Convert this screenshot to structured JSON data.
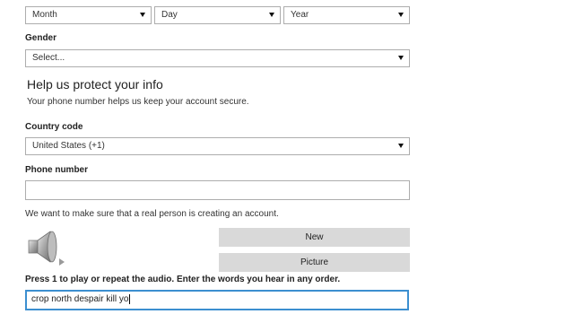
{
  "birthdate": {
    "month": "Month",
    "day": "Day",
    "year": "Year"
  },
  "gender": {
    "label": "Gender",
    "value": "Select..."
  },
  "protect": {
    "heading": "Help us protect your info",
    "subtext": "Your phone number helps us keep your account secure."
  },
  "country": {
    "label": "Country code",
    "value": "United States (+1)"
  },
  "phone": {
    "label": "Phone number",
    "value": ""
  },
  "captcha": {
    "intro": "We want to make sure that a real person is creating an account.",
    "new_label": "New",
    "picture_label": "Picture",
    "instructions": "Press 1 to play or repeat the audio. Enter the words you hear in any order.",
    "input_value": "crop north despair kill yo"
  },
  "icons": {
    "audio": "speaker-icon",
    "play": "play-icon"
  }
}
